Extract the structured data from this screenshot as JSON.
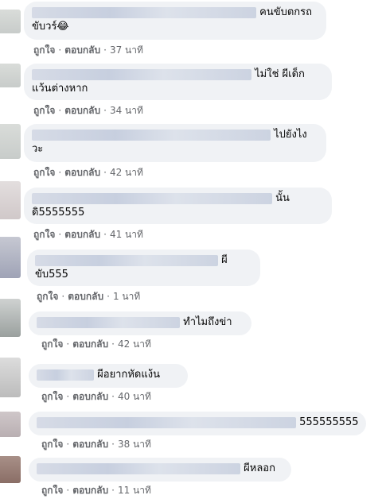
{
  "actions": {
    "like": "ถูกใจ",
    "reply": "ตอบกลับ",
    "sep": "·"
  },
  "comments": [
    {
      "line1": "คนขับตกรถ",
      "line2": "ขับวร์😂",
      "time": "37 นาที"
    },
    {
      "line1": "ไม่ใช่ ผีเด็ก",
      "line2": "แว้นต่างหาก",
      "time": "34 นาที"
    },
    {
      "line1": "ไปยังไง",
      "line2": "วะ",
      "time": "42 นาที"
    },
    {
      "line1": "นั้น",
      "line2": "ดิ5555555",
      "time": "41 นาที"
    },
    {
      "line1": "ผี",
      "line2": "ขับ555",
      "time": "1 นาที"
    },
    {
      "line1": "ทำไมถึงข่า",
      "line2": "",
      "time": "42 นาที"
    },
    {
      "line1": "ผีอยากหัดแง้น",
      "line2": "",
      "time": "40 นาที"
    },
    {
      "line1": "555555555",
      "line2": "",
      "time": "38 นาที"
    },
    {
      "line1": "ผีหลอก",
      "line2": "",
      "time": "11 นาที"
    }
  ]
}
